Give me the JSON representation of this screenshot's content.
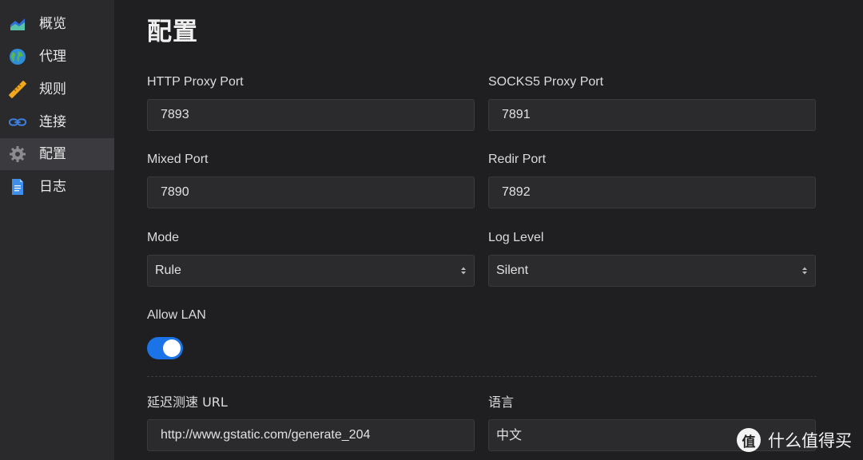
{
  "sidebar": {
    "items": [
      {
        "label": "概览",
        "icon": "chart-area-icon"
      },
      {
        "label": "代理",
        "icon": "globe-icon"
      },
      {
        "label": "规则",
        "icon": "ruler-icon"
      },
      {
        "label": "连接",
        "icon": "link-icon"
      },
      {
        "label": "配置",
        "icon": "gear-icon",
        "active": true
      },
      {
        "label": "日志",
        "icon": "document-icon"
      }
    ]
  },
  "page": {
    "title": "配置"
  },
  "fields": {
    "http_proxy_port": {
      "label": "HTTP Proxy Port",
      "value": "7893"
    },
    "socks5_proxy_port": {
      "label": "SOCKS5 Proxy Port",
      "value": "7891"
    },
    "mixed_port": {
      "label": "Mixed Port",
      "value": "7890"
    },
    "redir_port": {
      "label": "Redir Port",
      "value": "7892"
    },
    "mode": {
      "label": "Mode",
      "value": "Rule"
    },
    "log_level": {
      "label": "Log Level",
      "value": "Silent"
    },
    "allow_lan": {
      "label": "Allow LAN",
      "enabled": true
    },
    "latency_test_url": {
      "label": "延迟测速 URL",
      "value": "http://www.gstatic.com/generate_204"
    },
    "language": {
      "label": "语言",
      "value": "中文"
    }
  },
  "watermark": {
    "logo": "值",
    "text": "什么值得买"
  },
  "colors": {
    "accent": "#1a74e8",
    "background": "#1f1f21",
    "sidebar": "#2a2a2d",
    "sidebar_active": "#3b3b3f"
  }
}
